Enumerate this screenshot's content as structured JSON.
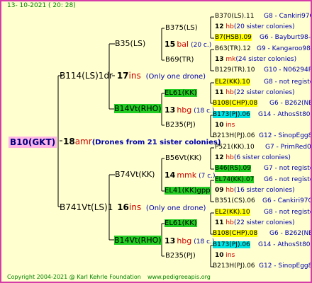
{
  "header": {
    "date": "13- 10-2021 ( 20: 28)"
  },
  "footer": {
    "copyright": "Copyright 2004-2021 @ Karl Kehrle Foundation",
    "site": "www.pedigreeapis.org"
  },
  "root": {
    "name": "B10(GKT)",
    "count": "18",
    "code": "amr",
    "note": "(Drones from 21 sister colonies)"
  },
  "level1": [
    {
      "name": "B114(LS)1dr",
      "count": "17",
      "code": "ins",
      "note": "(Only one drone)"
    },
    {
      "name": "B741Vt(LS)1",
      "count": "16",
      "code": "ins",
      "note": "(Only one drone)"
    }
  ],
  "level2": [
    {
      "name": "B35(LS)",
      "count": "15",
      "code": "bal",
      "note": "(20 c.)"
    },
    {
      "name": "B14Vt(RHO)",
      "count": "13",
      "code": "hbg",
      "note": "(18 c.)"
    },
    {
      "name": "B74Vt(KK)",
      "count": "14",
      "code": "mmk",
      "note": "(7 c.)"
    },
    {
      "name": "B14Vt(RHO)",
      "count": "13",
      "code": "hbg",
      "note": "(18 c.)"
    }
  ],
  "level3": [
    {
      "name": "B375(LS)"
    },
    {
      "name": "B69(TR)"
    },
    {
      "name": "EL61(KK)",
      "count": "11",
      "code": "hbg",
      "note": "(22 c.)"
    },
    {
      "name": "B235(PJ)",
      "count": "10",
      "code": "ins"
    },
    {
      "name": "B56Vt(KK)"
    },
    {
      "name": "EL41(KK)gpp",
      "count": "09",
      "code": "hbg",
      "note": "(16 c.)"
    },
    {
      "name": "EL61(KK)",
      "count": "11",
      "code": "hbg",
      "note": "(22 c.)"
    },
    {
      "name": "B235(PJ)",
      "count": "10",
      "code": "ins"
    }
  ],
  "level4": [
    {
      "name": "B370(LS).11",
      "pid": "G8 - Cankiri97Q"
    },
    {
      "count": "12",
      "code": "hb",
      "note": "(20 sister colonies)"
    },
    {
      "name": "B7(HSB).09",
      "pid": "G6 - Bayburt98-3"
    },
    {
      "name": "B63(TR).12",
      "pid": "G9 - Kangaroo98R"
    },
    {
      "count": "13",
      "code": "mk",
      "note": "(24 sister colonies)"
    },
    {
      "name": "B129(TR).10",
      "pid": "G10 - N06294R"
    },
    {
      "name": "EL2(KK).10",
      "pid": "G8 - not registe"
    },
    {
      "count": "11",
      "code": "hb",
      "note": "(22 sister colonies)"
    },
    {
      "name": "B108(CHP).08",
      "pid": "G6 - B262(NE)"
    },
    {
      "name": "B173(PJ).06",
      "pid": "G14 - AthosSt80R"
    },
    {
      "count": "10",
      "code": "ins"
    },
    {
      "name": "B213H(PJ).06",
      "pid": "G12 - SinopEgg86R"
    },
    {
      "name": "P521(KK).10",
      "pid": "G7 - PrimRed01"
    },
    {
      "count": "12",
      "code": "hb",
      "note": "(6 sister colonies)"
    },
    {
      "name": "B46(RS).09",
      "pid": "G7 - not registe"
    },
    {
      "name": "EL74(KK).07",
      "pid": "G6 - not registe"
    },
    {
      "count": "09",
      "code": "hb",
      "note": "(16 sister colonies)"
    },
    {
      "name": "B351(CS).06",
      "pid": "G6 - Cankiri97Q"
    },
    {
      "name": "EL2(KK).10",
      "pid": "G8 - not registe"
    },
    {
      "count": "11",
      "code": "hb",
      "note": "(22 sister colonies)"
    },
    {
      "name": "B108(CHP).08",
      "pid": "G6 - B262(NE)"
    },
    {
      "name": "B173(PJ).06",
      "pid": "G14 - AthosSt80R"
    },
    {
      "count": "10",
      "code": "ins"
    },
    {
      "name": "B213H(PJ).06",
      "pid": "G12 - SinopEgg86R"
    }
  ],
  "colors": {
    "border": "#d63ca8",
    "background": "#ffffcf",
    "lines": "#000000",
    "yellow_highlight": "#ffff00",
    "green_highlight": "#22cc22",
    "cyan_highlight": "#00e5e5",
    "root_highlight": "#ffb6e6"
  }
}
